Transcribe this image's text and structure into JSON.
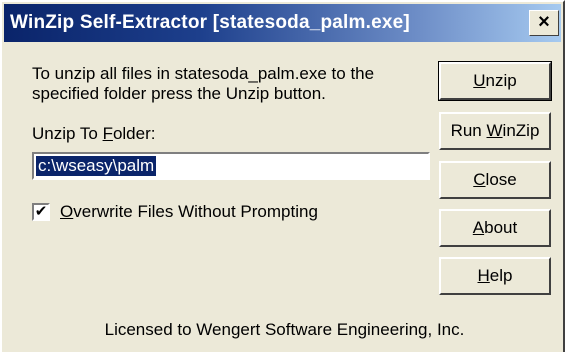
{
  "window": {
    "title": "WinZip Self-Extractor [statesoda_palm.exe]",
    "close_label": "×"
  },
  "content": {
    "message": "To unzip all files in statesoda_palm.exe to the specified folder press the Unzip button.",
    "folder_label": "Unzip To Folder:",
    "folder_value": "c:\\wseasy\\palm",
    "overwrite_label": "Overwrite Files Without Prompting",
    "overwrite_checked": true,
    "license": "Licensed to Wengert Software Engineering, Inc."
  },
  "buttons": {
    "unzip": "Unzip",
    "run_winzip": "Run WinZip",
    "close": "Close",
    "about": "About",
    "help": "Help"
  },
  "colors": {
    "titlebar_start": "#0a246a",
    "titlebar_end": "#a6caf0",
    "dialog_bg": "#ece9d8",
    "selection": "#0a246a"
  }
}
